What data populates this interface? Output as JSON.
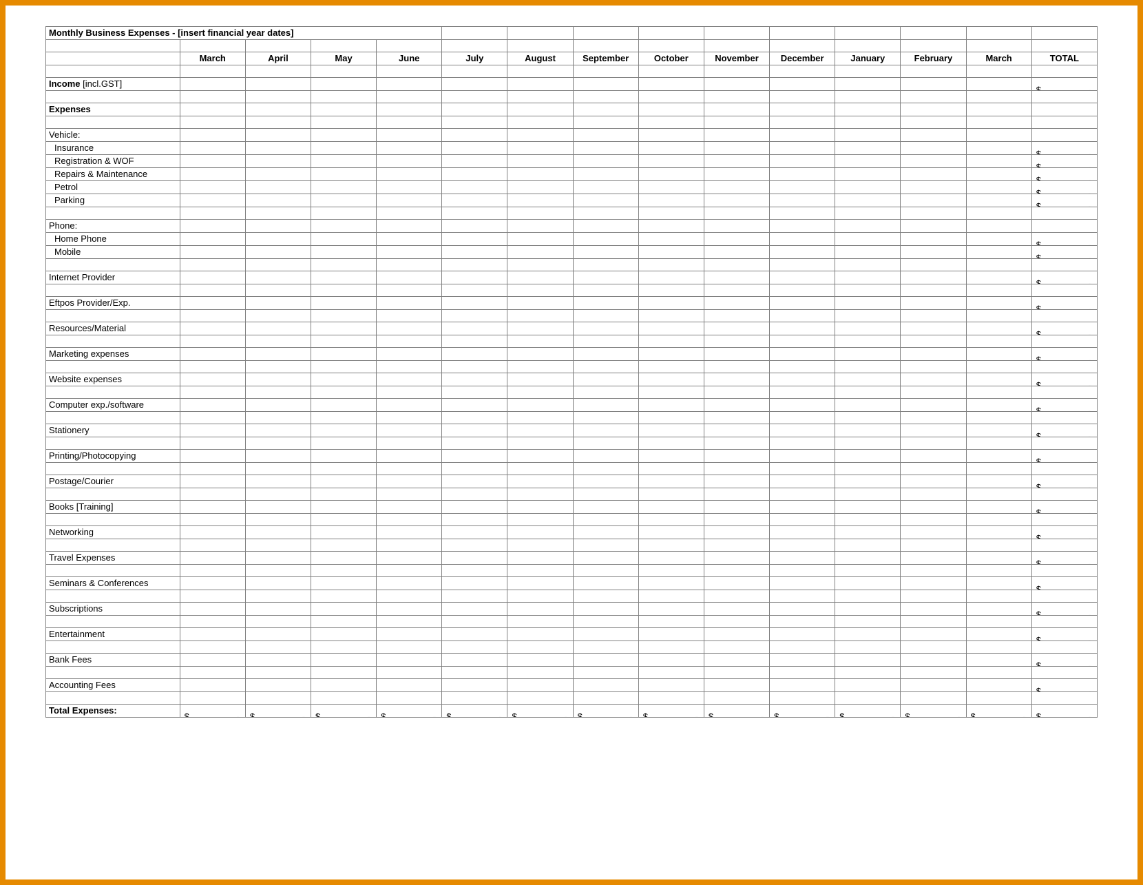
{
  "title": "Monthly Business Expenses - [insert financial year dates]",
  "months": [
    "March",
    "April",
    "May",
    "June",
    "July",
    "August",
    "September",
    "October",
    "November",
    "December",
    "January",
    "February",
    "March"
  ],
  "total_header": "TOTAL",
  "currency_symbol": "$",
  "dash": "-",
  "income": {
    "label": "Income",
    "suffix": " [incl.GST]"
  },
  "expenses_header": "Expenses",
  "total_expenses_label": "Total Expenses:",
  "groups": [
    {
      "heading": "Vehicle:",
      "items": [
        {
          "label": "Insurance",
          "indent": true
        },
        {
          "label": "Registration & WOF",
          "indent": true
        },
        {
          "label": "Repairs & Maintenance",
          "indent": true
        },
        {
          "label": "Petrol",
          "indent": true
        },
        {
          "label": "Parking",
          "indent": true
        }
      ],
      "spacer_after": true
    },
    {
      "heading": "Phone:",
      "items": [
        {
          "label": "Home Phone",
          "indent": true
        },
        {
          "label": "Mobile",
          "indent": true
        }
      ],
      "spacer_after": true
    },
    {
      "items": [
        {
          "label": "Internet Provider"
        }
      ],
      "spacer_after": true
    },
    {
      "items": [
        {
          "label": "Eftpos Provider/Exp."
        }
      ],
      "spacer_after": true
    },
    {
      "items": [
        {
          "label": "Resources/Material"
        }
      ],
      "spacer_after": true
    },
    {
      "items": [
        {
          "label": "Marketing expenses"
        }
      ],
      "spacer_after": true
    },
    {
      "items": [
        {
          "label": "Website expenses"
        }
      ],
      "spacer_after": true
    },
    {
      "items": [
        {
          "label": "Computer exp./software"
        }
      ],
      "spacer_after": true
    },
    {
      "items": [
        {
          "label": "Stationery"
        }
      ],
      "spacer_after": true
    },
    {
      "items": [
        {
          "label": "Printing/Photocopying"
        }
      ],
      "spacer_after": true
    },
    {
      "items": [
        {
          "label": "Postage/Courier"
        }
      ],
      "spacer_after": true
    },
    {
      "items": [
        {
          "label": "Books [Training]"
        }
      ],
      "spacer_after": true
    },
    {
      "items": [
        {
          "label": "Networking"
        }
      ],
      "spacer_after": true
    },
    {
      "items": [
        {
          "label": "Travel Expenses"
        }
      ],
      "spacer_after": true
    },
    {
      "items": [
        {
          "label": "Seminars & Conferences"
        }
      ],
      "spacer_after": true
    },
    {
      "items": [
        {
          "label": "Subscriptions"
        }
      ],
      "spacer_after": true
    },
    {
      "items": [
        {
          "label": "Entertainment"
        }
      ],
      "spacer_after": true
    },
    {
      "items": [
        {
          "label": "Bank Fees"
        }
      ],
      "spacer_after": true
    },
    {
      "items": [
        {
          "label": "Accounting Fees"
        }
      ],
      "spacer_after": true
    }
  ]
}
